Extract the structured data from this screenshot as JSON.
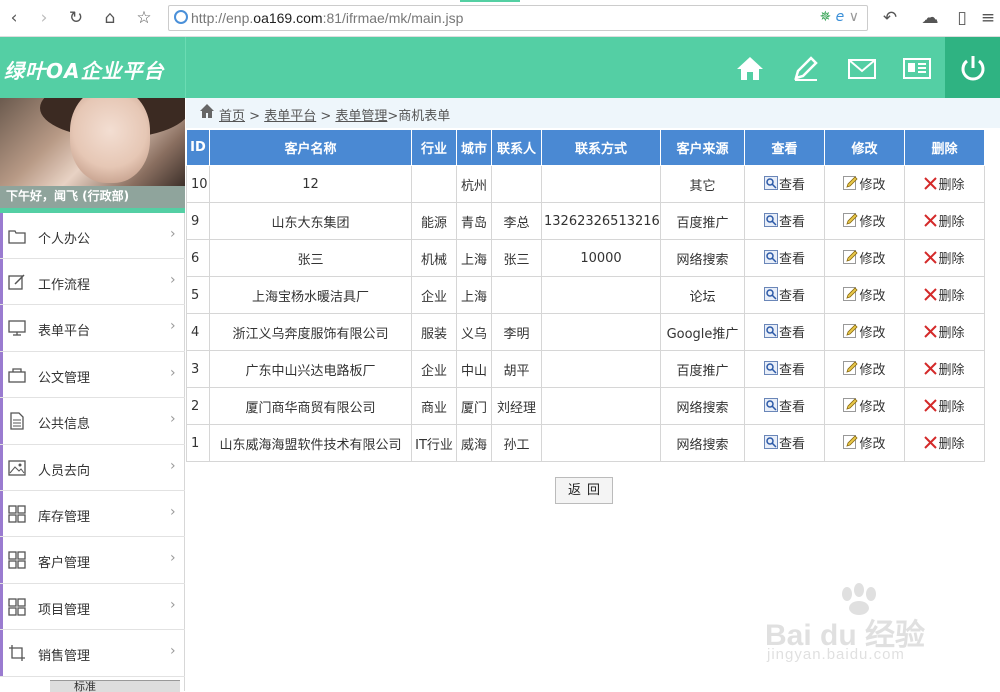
{
  "browser": {
    "url_prefix": "http://enp.",
    "url_host": "oa169.com",
    "url_suffix": ":81/ifrmae/mk/main.jsp"
  },
  "app": {
    "logo": "绿叶OA企业平台"
  },
  "user": {
    "greeting": "下午好，闻飞 (行政部)"
  },
  "sidebar": {
    "items": [
      {
        "label": "个人办公",
        "icon": "folder-icon"
      },
      {
        "label": "工作流程",
        "icon": "edit-icon"
      },
      {
        "label": "表单平台",
        "icon": "monitor-icon"
      },
      {
        "label": "公文管理",
        "icon": "bag-icon"
      },
      {
        "label": "公共信息",
        "icon": "document-icon"
      },
      {
        "label": "人员去向",
        "icon": "image-icon"
      },
      {
        "label": "库存管理",
        "icon": "grid-icon"
      },
      {
        "label": "客户管理",
        "icon": "grid-icon"
      },
      {
        "label": "项目管理",
        "icon": "grid-icon"
      },
      {
        "label": "销售管理",
        "icon": "crop-icon"
      }
    ],
    "toolbar_text": "标准"
  },
  "breadcrumb": {
    "home": "首页",
    "sep1": " > ",
    "platform": "表单平台",
    "sep2": " > ",
    "manage": "表单管理",
    "current": ">商机表单"
  },
  "table": {
    "headers": [
      "ID",
      "客户名称",
      "行业",
      "城市",
      "联系人",
      "联系方式",
      "客户来源",
      "查看",
      "修改",
      "删除"
    ],
    "actions": {
      "view": "查看",
      "edit": "修改",
      "delete": "删除"
    },
    "rows": [
      {
        "id": "10",
        "name": "12",
        "industry": "",
        "city": "杭州",
        "contact": "",
        "phone": "",
        "source": "其它"
      },
      {
        "id": "9",
        "name": "山东大东集团",
        "industry": "能源",
        "city": "青岛",
        "contact": "李总",
        "phone": "13262326513216",
        "source": "百度推广"
      },
      {
        "id": "6",
        "name": "张三",
        "industry": "机械",
        "city": "上海",
        "contact": "张三",
        "phone": "10000",
        "source": "网络搜索"
      },
      {
        "id": "5",
        "name": "上海宝杨水暖洁具厂",
        "industry": "企业",
        "city": "上海",
        "contact": "",
        "phone": "",
        "source": "论坛"
      },
      {
        "id": "4",
        "name": "浙江义乌奔度服饰有限公司",
        "industry": "服装",
        "city": "义乌",
        "contact": "李明",
        "phone": "",
        "source": "Google推广"
      },
      {
        "id": "3",
        "name": "广东中山兴达电路板厂",
        "industry": "企业",
        "city": "中山",
        "contact": "胡平",
        "phone": "",
        "source": "百度推广"
      },
      {
        "id": "2",
        "name": "厦门商华商贸有限公司",
        "industry": "商业",
        "city": "厦门",
        "contact": "刘经理",
        "phone": "",
        "source": "网络搜索"
      },
      {
        "id": "1",
        "name": "山东威海海盟软件技术有限公司",
        "industry": "IT行业",
        "city": "威海",
        "contact": "孙工",
        "phone": "",
        "source": "网络搜索"
      }
    ]
  },
  "back_button": "返回",
  "watermark": {
    "main": "Bai du 经验",
    "sub": "jingyan.baidu.com"
  },
  "colors": {
    "header_green": "#54cfa4",
    "table_header_blue": "#4a89d3",
    "power_bg": "#2fb382"
  }
}
